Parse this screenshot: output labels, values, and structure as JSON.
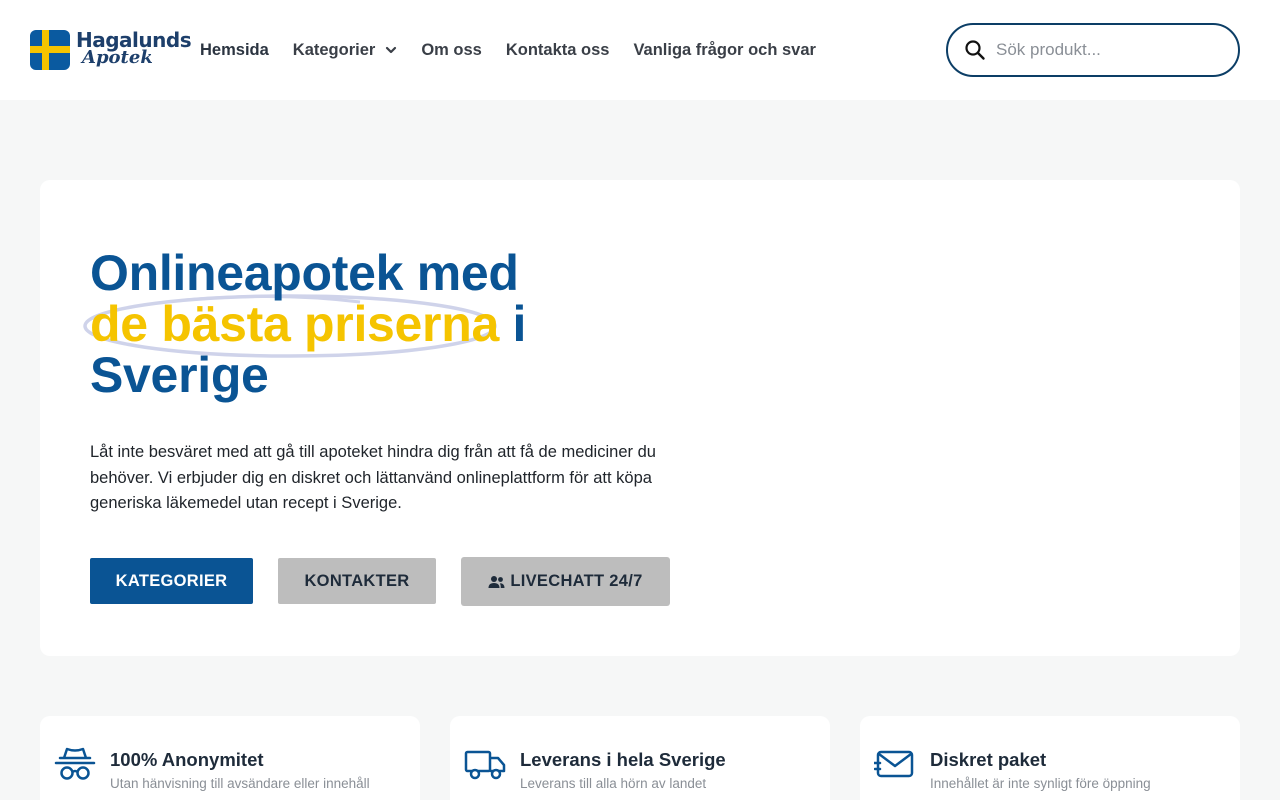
{
  "brand": {
    "name": "Hagalunds",
    "sub": "Apotek"
  },
  "nav": {
    "items": [
      "Hemsida",
      "Kategorier",
      "Om oss",
      "Kontakta oss",
      "Vanliga frågor och svar"
    ]
  },
  "search": {
    "placeholder": "Sök produkt...",
    "value": ""
  },
  "hero": {
    "title_line1": "Onlineapotek med",
    "title_highlight": "de bästa priserna",
    "title_after_highlight": " i",
    "title_line3": "Sverige",
    "description": "Låt inte besväret med att gå till apoteket hindra dig från att få de mediciner du behöver. Vi erbjuder dig en diskret och lättanvänd onlineplattform för att köpa generiska läkemedel utan recept i Sverige.",
    "buttons": {
      "categories": "KATEGORIER",
      "contacts": "KONTAKTER",
      "livechat": "LIVECHATT 24/7"
    }
  },
  "features": [
    {
      "icon": "incognito-icon",
      "title": "100% Anonymitet",
      "subtitle": "Utan hänvisning till avsändare eller innehåll"
    },
    {
      "icon": "truck-icon",
      "title": "Leverans i hela Sverige",
      "subtitle": "Leverans till alla hörn av landet"
    },
    {
      "icon": "envelope-icon",
      "title": "Diskret paket",
      "subtitle": "Innehållet är inte synligt före öppning"
    }
  ],
  "colors": {
    "primary": "#0a5494",
    "accent": "#f5c400",
    "button_gray": "#bdbdbd",
    "background": "#f6f7f7"
  }
}
